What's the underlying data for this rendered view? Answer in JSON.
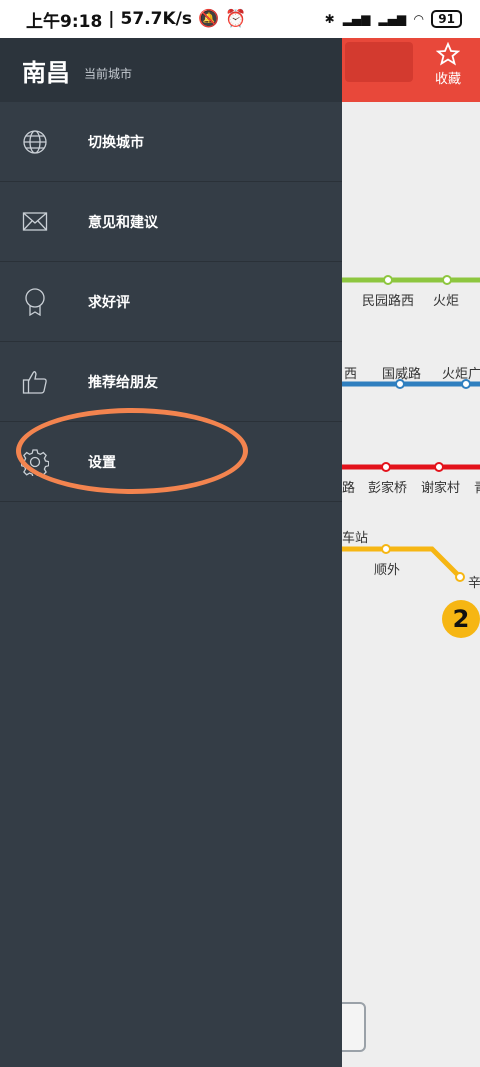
{
  "status_bar": {
    "time": "上午9:18",
    "speed": "57.7K/s",
    "battery": "91"
  },
  "app": {
    "favorite_label": "收藏"
  },
  "map": {
    "stations": [
      "民园路西",
      "火炬",
      "西",
      "国威路",
      "火炬广",
      "路",
      "彭家桥",
      "谢家村",
      "青",
      "车站",
      "顺外",
      "辛"
    ],
    "line_number": "2",
    "colors": {
      "green": "#8dc63f",
      "blue": "#2f7fbf",
      "red": "#e3121b",
      "yellow": "#f6b613"
    }
  },
  "drawer": {
    "city": "南昌",
    "city_subtitle": "当前城市",
    "items": [
      {
        "label": "切换城市",
        "icon": "globe-icon"
      },
      {
        "label": "意见和建议",
        "icon": "envelope-icon"
      },
      {
        "label": "求好评",
        "icon": "award-icon"
      },
      {
        "label": "推荐给朋友",
        "icon": "thumbs-up-icon"
      },
      {
        "label": "设置",
        "icon": "gear-icon"
      }
    ]
  },
  "annotation_color": "#f3844f"
}
